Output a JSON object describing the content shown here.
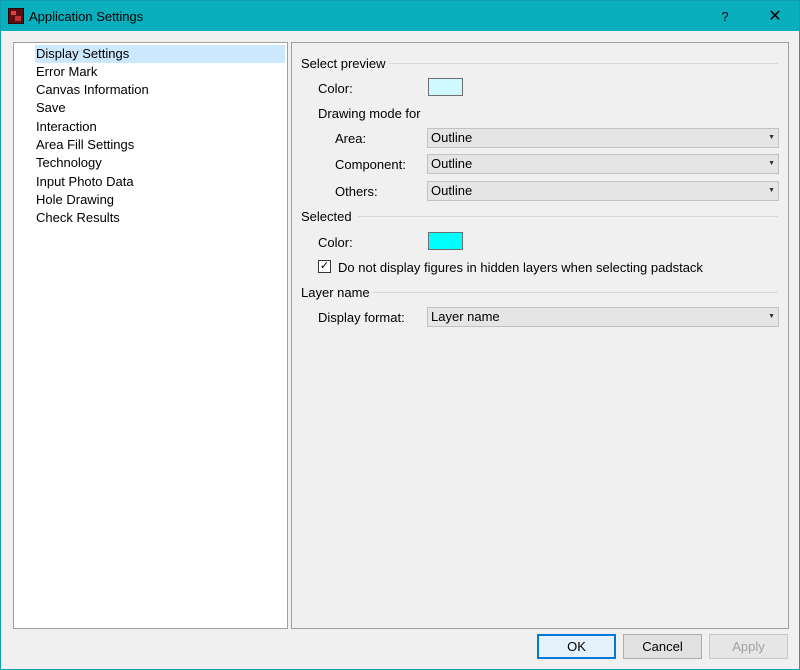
{
  "window": {
    "title": "Application Settings",
    "help_glyph": "?",
    "close_glyph": "✕"
  },
  "nav": {
    "items": [
      {
        "label": "Display Settings",
        "selected": true
      },
      {
        "label": "Error Mark"
      },
      {
        "label": "Canvas Information"
      },
      {
        "label": "Save"
      },
      {
        "label": "Interaction"
      },
      {
        "label": "Area Fill Settings"
      },
      {
        "label": "Technology"
      },
      {
        "label": "Input Photo Data"
      },
      {
        "label": "Hole Drawing"
      },
      {
        "label": "Check Results"
      }
    ]
  },
  "select_preview": {
    "title": "Select preview",
    "color_label": "Color:",
    "color_value": "#cff8ff",
    "drawing_mode_label": "Drawing mode for",
    "area_label": "Area:",
    "area_value": "Outline",
    "component_label": "Component:",
    "component_value": "Outline",
    "others_label": "Others:",
    "others_value": "Outline"
  },
  "selected": {
    "title": "Selected",
    "color_label": "Color:",
    "color_value": "#00ffff",
    "hide_hidden_label": "Do not display figures in hidden layers when selecting padstack",
    "hide_hidden_checked": true
  },
  "layer_name": {
    "title": "Layer name",
    "display_format_label": "Display format:",
    "display_format_value": "Layer name"
  },
  "buttons": {
    "ok": "OK",
    "cancel": "Cancel",
    "apply": "Apply"
  },
  "colors": {
    "titlebar": "#0aafbd",
    "selection": "#cce8ff"
  }
}
